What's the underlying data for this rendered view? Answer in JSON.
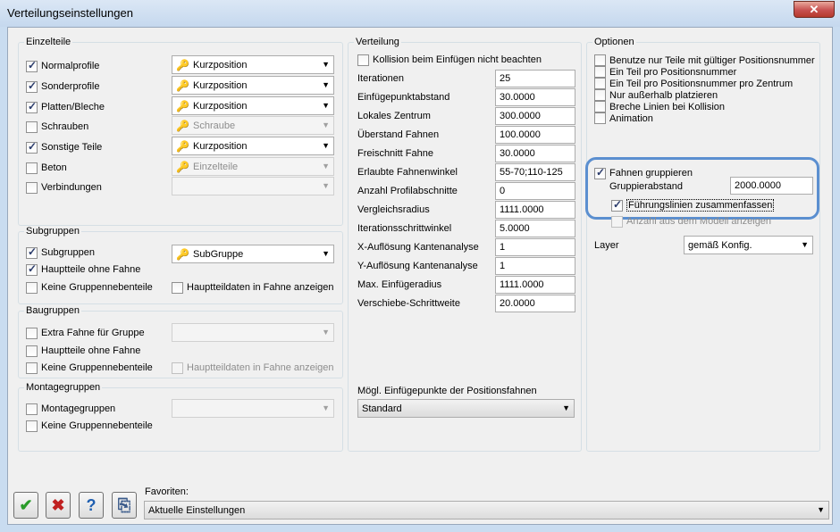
{
  "window": {
    "title": "Verteilungseinstellungen",
    "close_glyph": "✕"
  },
  "einzelteile": {
    "legend": "Einzelteile",
    "rows": [
      {
        "label": "Normalprofile",
        "checked": true,
        "combo": "Kurzposition",
        "enabled": true
      },
      {
        "label": "Sonderprofile",
        "checked": true,
        "combo": "Kurzposition",
        "enabled": true
      },
      {
        "label": "Platten/Bleche",
        "checked": true,
        "combo": "Kurzposition",
        "enabled": true
      },
      {
        "label": "Schrauben",
        "checked": false,
        "combo": "Schraube",
        "enabled": false
      },
      {
        "label": "Sonstige Teile",
        "checked": true,
        "combo": "Kurzposition",
        "enabled": true
      },
      {
        "label": "Beton",
        "checked": false,
        "combo": "Einzelteile",
        "enabled": false
      },
      {
        "label": "Verbindungen",
        "checked": false,
        "combo": "",
        "enabled": false
      }
    ]
  },
  "subgruppen": {
    "legend": "Subgruppen",
    "subgruppen_label": "Subgruppen",
    "subgruppen_combo": "SubGruppe",
    "hauptteile_label": "Hauptteile ohne Fahne",
    "keine_label": "Keine Gruppennebenteile",
    "hauptteildaten_label": "Hauptteildaten in Fahne anzeigen"
  },
  "baugruppen": {
    "legend": "Baugruppen",
    "extra_label": "Extra Fahne für Gruppe",
    "hauptteile_label": "Hauptteile ohne Fahne",
    "keine_label": "Keine Gruppennebenteile",
    "hauptteildaten_label": "Hauptteildaten in Fahne anzeigen"
  },
  "montagegruppen": {
    "legend": "Montagegruppen",
    "montage_label": "Montagegruppen",
    "keine_label": "Keine Gruppennebenteile"
  },
  "verteilung": {
    "legend": "Verteilung",
    "kollision_label": "Kollision beim Einfügen nicht beachten",
    "fields": [
      {
        "label": "Iterationen",
        "value": "25"
      },
      {
        "label": "Einfügepunktabstand",
        "value": "30.0000"
      },
      {
        "label": "Lokales Zentrum",
        "value": "300.0000"
      },
      {
        "label": "Überstand Fahnen",
        "value": "100.0000"
      },
      {
        "label": "Freischnitt Fahne",
        "value": "30.0000"
      },
      {
        "label": "Erlaubte Fahnenwinkel",
        "value": "55-70;110-125"
      },
      {
        "label": "Anzahl Profilabschnitte",
        "value": "0"
      },
      {
        "label": "Vergleichsradius",
        "value": "1111.0000"
      },
      {
        "label": "Iterationsschrittwinkel",
        "value": "5.0000"
      },
      {
        "label": "X-Auflösung Kantenanalyse",
        "value": "1"
      },
      {
        "label": "Y-Auflösung Kantenanalyse",
        "value": "1"
      },
      {
        "label": "Max. Einfügeradius",
        "value": "1111.0000"
      },
      {
        "label": "Verschiebe-Schrittweite",
        "value": "20.0000"
      }
    ],
    "einfuegepunkte_label": "Mögl. Einfügepunkte der Positionsfahnen",
    "einfuegepunkte_value": "Standard"
  },
  "optionen": {
    "legend": "Optionen",
    "checks": [
      "Benutze nur Teile mit gültiger Positionsnummer",
      "Ein Teil pro Positionsnummer",
      "Ein Teil pro Positionsnummer pro Zentrum",
      "Nur außerhalb platzieren",
      "Breche Linien bei Kollision",
      "Animation"
    ],
    "fahnen_label": "Fahnen gruppieren",
    "gruppierabstand_label": "Gruppierabstand",
    "gruppierabstand_value": "2000.0000",
    "fuehrungslinien_label": "Führungslinien zusammenfassen",
    "anzahl_label": "Anzahl aus dem Modell anzeigen",
    "layer_label": "Layer",
    "layer_value": "gemäß Konfig."
  },
  "footer": {
    "favoriten_label": "Favoriten:",
    "favoriten_value": "Aktuelle Einstellungen",
    "ok_glyph": "✔",
    "cancel_glyph": "✖",
    "help_glyph": "?",
    "copy_glyph": "⎘"
  },
  "icons": {
    "combo_icon": "🔑",
    "arrow": "▼"
  }
}
